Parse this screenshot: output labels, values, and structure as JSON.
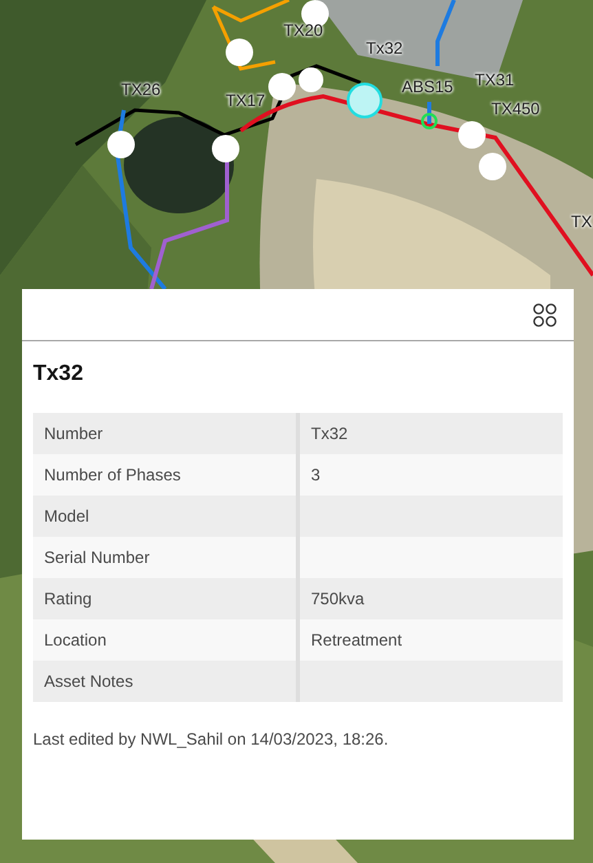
{
  "map": {
    "kind": "picture",
    "labels": [
      {
        "text": "TX20"
      },
      {
        "text": "Tx32"
      },
      {
        "text": "TX26"
      },
      {
        "text": "TX17"
      },
      {
        "text": "ABS15"
      },
      {
        "text": "TX31"
      },
      {
        "text": "TX450"
      },
      {
        "text": "TX"
      }
    ]
  },
  "popup": {
    "title": "Tx32",
    "rows": [
      {
        "field": "Number",
        "value": "Tx32"
      },
      {
        "field": "Number of Phases",
        "value": "3"
      },
      {
        "field": "Model"
      },
      {
        "field": "Serial Number"
      },
      {
        "field": "Rating",
        "value": "750kva"
      },
      {
        "field": "Location",
        "value": "Retreatment"
      },
      {
        "field": "Asset Notes"
      }
    ],
    "footer": "Last edited by NWL_Sahil on 14/03/2023, 18:26."
  }
}
